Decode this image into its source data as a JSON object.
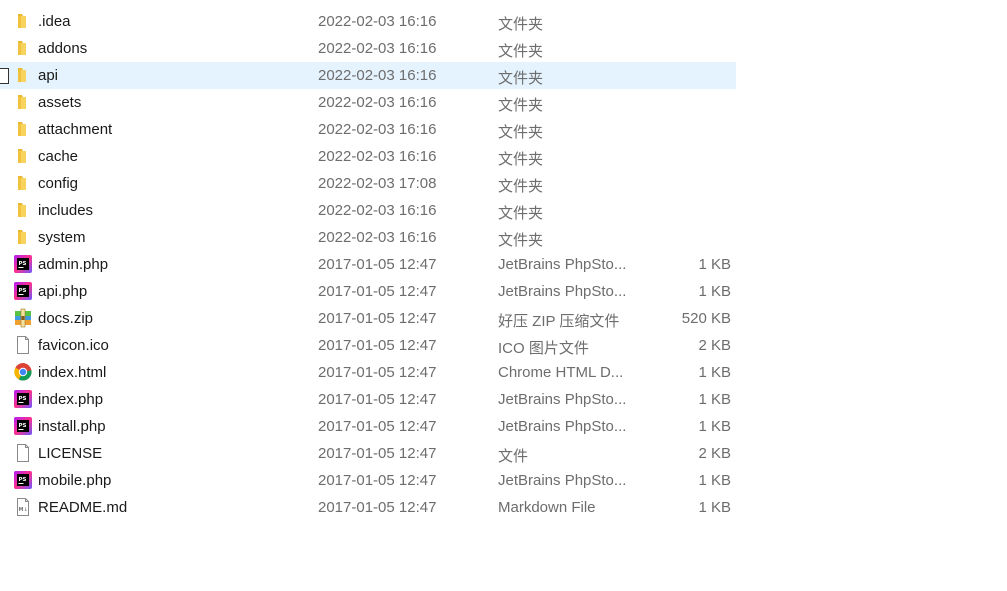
{
  "files": [
    {
      "name": ".idea",
      "date": "2022-02-03 16:16",
      "type": "文件夹",
      "size": "",
      "icon": "folder-icon",
      "selected": false
    },
    {
      "name": "addons",
      "date": "2022-02-03 16:16",
      "type": "文件夹",
      "size": "",
      "icon": "folder-icon",
      "selected": false
    },
    {
      "name": "api",
      "date": "2022-02-03 16:16",
      "type": "文件夹",
      "size": "",
      "icon": "folder-icon",
      "selected": true
    },
    {
      "name": "assets",
      "date": "2022-02-03 16:16",
      "type": "文件夹",
      "size": "",
      "icon": "folder-icon",
      "selected": false
    },
    {
      "name": "attachment",
      "date": "2022-02-03 16:16",
      "type": "文件夹",
      "size": "",
      "icon": "folder-icon",
      "selected": false
    },
    {
      "name": "cache",
      "date": "2022-02-03 16:16",
      "type": "文件夹",
      "size": "",
      "icon": "folder-icon",
      "selected": false
    },
    {
      "name": "config",
      "date": "2022-02-03 17:08",
      "type": "文件夹",
      "size": "",
      "icon": "folder-icon",
      "selected": false
    },
    {
      "name": "includes",
      "date": "2022-02-03 16:16",
      "type": "文件夹",
      "size": "",
      "icon": "folder-icon",
      "selected": false
    },
    {
      "name": "system",
      "date": "2022-02-03 16:16",
      "type": "文件夹",
      "size": "",
      "icon": "folder-icon",
      "selected": false
    },
    {
      "name": "admin.php",
      "date": "2017-01-05 12:47",
      "type": "JetBrains PhpSto...",
      "size": "1 KB",
      "icon": "phpstorm-icon",
      "selected": false
    },
    {
      "name": "api.php",
      "date": "2017-01-05 12:47",
      "type": "JetBrains PhpSto...",
      "size": "1 KB",
      "icon": "phpstorm-icon",
      "selected": false
    },
    {
      "name": "docs.zip",
      "date": "2017-01-05 12:47",
      "type": "好压 ZIP 压缩文件",
      "size": "520 KB",
      "icon": "zip-archive-icon",
      "selected": false
    },
    {
      "name": "favicon.ico",
      "date": "2017-01-05 12:47",
      "type": "ICO 图片文件",
      "size": "2 KB",
      "icon": "blank-file-icon",
      "selected": false
    },
    {
      "name": "index.html",
      "date": "2017-01-05 12:47",
      "type": "Chrome HTML D...",
      "size": "1 KB",
      "icon": "chrome-icon",
      "selected": false
    },
    {
      "name": "index.php",
      "date": "2017-01-05 12:47",
      "type": "JetBrains PhpSto...",
      "size": "1 KB",
      "icon": "phpstorm-icon",
      "selected": false
    },
    {
      "name": "install.php",
      "date": "2017-01-05 12:47",
      "type": "JetBrains PhpSto...",
      "size": "1 KB",
      "icon": "phpstorm-icon",
      "selected": false
    },
    {
      "name": "LICENSE",
      "date": "2017-01-05 12:47",
      "type": "文件",
      "size": "2 KB",
      "icon": "blank-file-icon",
      "selected": false
    },
    {
      "name": "mobile.php",
      "date": "2017-01-05 12:47",
      "type": "JetBrains PhpSto...",
      "size": "1 KB",
      "icon": "phpstorm-icon",
      "selected": false
    },
    {
      "name": "README.md",
      "date": "2017-01-05 12:47",
      "type": "Markdown File",
      "size": "1 KB",
      "icon": "markdown-file-icon",
      "selected": false
    }
  ],
  "colors": {
    "selection": "#e5f3ff",
    "folder": "#f5c542",
    "phpstorm": "#8a2be2",
    "secondary_text": "#6d6d6d"
  }
}
